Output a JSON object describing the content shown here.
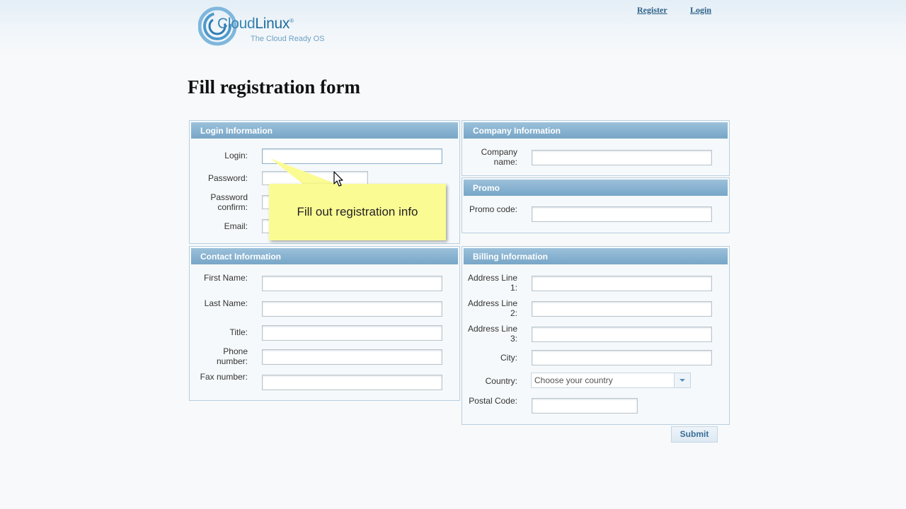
{
  "header": {
    "logo_brand_prefix": "Cloud",
    "logo_brand_suffix": "Linux",
    "logo_trademark": "®",
    "logo_tagline": "The Cloud Ready OS",
    "register_link": "Register",
    "login_link": "Login"
  },
  "page_title": "Fill registration form",
  "login_info": {
    "heading": "Login Information",
    "login_label": "Login:",
    "password_label": "Password:",
    "password_confirm_label": "Password confirm:",
    "email_label": "Email:"
  },
  "company_info": {
    "heading": "Company Information",
    "company_name_label": "Company name:"
  },
  "promo": {
    "heading": "Promo",
    "promo_code_label": "Promo code:"
  },
  "contact_info": {
    "heading": "Contact Information",
    "first_name_label": "First Name:",
    "last_name_label": "Last Name:",
    "title_label": "Title:",
    "phone_label": "Phone number:",
    "fax_label": "Fax number:"
  },
  "billing_info": {
    "heading": "Billing Information",
    "address1_label": "Address Line 1:",
    "address2_label": "Address Line 2:",
    "address3_label": "Address Line 3:",
    "city_label": "City:",
    "country_label": "Country:",
    "country_selected": "Choose your country",
    "postal_label": "Postal Code:"
  },
  "submit_label": "Submit",
  "tooltip_text": "Fill out registration info",
  "colors": {
    "panel_header": "#85b0cf",
    "tooltip_bg": "#fbfb94",
    "link": "#2a5f86"
  }
}
